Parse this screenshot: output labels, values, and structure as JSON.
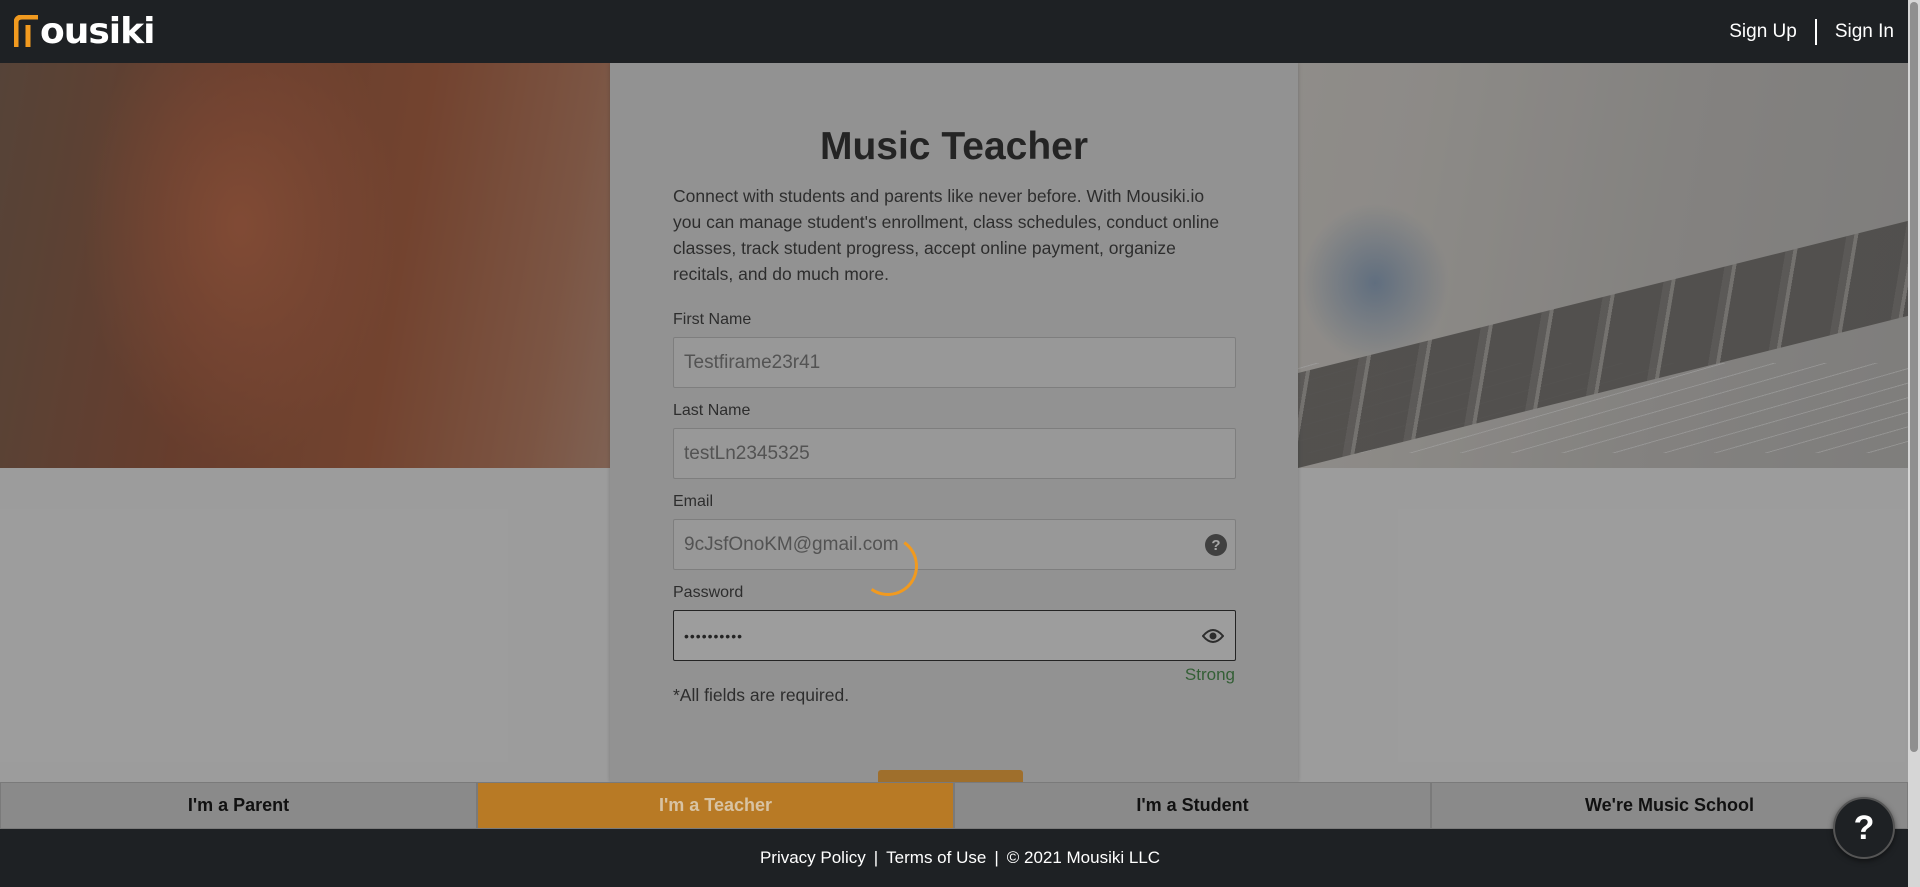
{
  "header": {
    "logo_text": "ousiki",
    "logo_letter": "m",
    "sign_up": "Sign Up",
    "sign_in": "Sign In"
  },
  "form": {
    "title": "Music Teacher",
    "intro": "Connect with students and parents like never before. With Mousiki.io you can manage student's enrollment, class schedules, conduct online classes, track student progress, accept online payment, organize recitals, and do much more.",
    "first_name_label": "First Name",
    "first_name_value": "Testfirame23r41",
    "last_name_label": "Last Name",
    "last_name_value": "testLn2345325",
    "email_label": "Email",
    "email_value": "9cJsfOnoKM@gmail.com",
    "password_label": "Password",
    "password_value": "••••••••••",
    "password_strength": "Strong",
    "required_note": "*All fields are required."
  },
  "tabs": [
    {
      "label": "I'm a Parent",
      "selected": false
    },
    {
      "label": "I'm a Teacher",
      "selected": true
    },
    {
      "label": "I'm a Student",
      "selected": false
    },
    {
      "label": "We're Music School",
      "selected": false
    }
  ],
  "footer": {
    "privacy": "Privacy Policy",
    "terms": "Terms of Use",
    "copyright": "© 2021 Mousiki LLC"
  },
  "help_fab": "?",
  "colors": {
    "brand_orange": "#f19a1f",
    "header_bg": "#1e2124",
    "strength_green": "#2e7d32"
  }
}
